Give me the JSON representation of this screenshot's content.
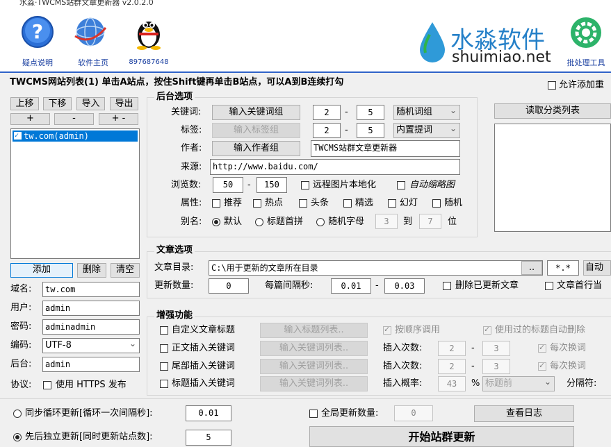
{
  "window": {
    "title": "水淼·TWCMS站群文章更新器 v2.0.2.0"
  },
  "toolbar": {
    "help_label": "疑点说明",
    "home_label": "软件主页",
    "qq_label": "897687648",
    "brand_cn": "水淼软件",
    "brand_en": "shuimiao.net",
    "batch_label": "批处理工具"
  },
  "sitelist": {
    "header": "TWCMS网站列表(1)  单击A站点，按住Shift键再单击B站点，可以A到B连续打勾",
    "allow_add": "允许添加重",
    "btn_up": "上移",
    "btn_down": "下移",
    "btn_import": "导入",
    "btn_export": "导出",
    "btn_plus1": "+",
    "btn_minus": "-",
    "btn_plusminus": "+ -",
    "items": [
      "tw.com(admin)"
    ],
    "btn_add": "添加",
    "btn_delete": "删除",
    "btn_clear": "清空",
    "domain_label": "域名:",
    "domain_value": "tw.com",
    "user_label": "用户:",
    "user_value": "admin",
    "pass_label": "密码:",
    "pass_value": "adminadmin",
    "encoding_label": "编码:",
    "encoding_value": "UTF-8",
    "backend_label": "后台:",
    "backend_value": "admin",
    "protocol_label": "协议:",
    "https_label": "使用 HTTPS 发布"
  },
  "backend": {
    "title": "后台选项",
    "keyword_label": "关键词:",
    "keyword_btn": "输入关键词组",
    "keyword_min": "2",
    "keyword_max": "5",
    "keyword_mode": "随机词组",
    "tag_label": "标签:",
    "tag_btn": "输入标签组",
    "tag_min": "2",
    "tag_max": "5",
    "tag_mode": "内置提词",
    "author_label": "作者:",
    "author_btn": "输入作者组",
    "author_value": "TWCMS站群文章更新器",
    "source_label": "来源:",
    "source_value": "http://www.baidu.com/",
    "views_label": "浏览数:",
    "views_min": "50",
    "views_max": "150",
    "remote_img": "远程图片本地化",
    "auto_thumb": "自动缩略图",
    "attr_label": "属性:",
    "attrs": [
      "推荐",
      "热点",
      "头条",
      "精选",
      "幻灯",
      "随机"
    ],
    "alias_label": "别名:",
    "alias_default": "默认",
    "alias_pinyin": "标题首拼",
    "alias_random": "随机字母",
    "alias_len_min": "3",
    "alias_to": "到",
    "alias_len_max": "7",
    "alias_unit": "位",
    "dash": "-",
    "read_cat_btn": "读取分类列表"
  },
  "article": {
    "title": "文章选项",
    "dir_label": "文章目录:",
    "dir_value": "C:\\用于更新的文章所在目录",
    "browse_btn": "..",
    "ext_value": "*.*",
    "auto_btn": "自动识",
    "count_label": "更新数量:",
    "count_value": "0",
    "interval_label": "每篇间隔秒:",
    "interval_min": "0.01",
    "interval_max": "0.03",
    "delete_updated": "删除已更新文章",
    "first_line": "文章首行当"
  },
  "enhance": {
    "title": "增强功能",
    "rows": [
      {
        "check": "自定义文章标题",
        "btn": "输入标题列表.."
      },
      {
        "check": "正文插入关键词",
        "btn": "输入关键词列表..",
        "label": "插入次数:",
        "min": "2",
        "max": "3",
        "each": "每次换词"
      },
      {
        "check": "尾部插入关键词",
        "btn": "输入关键词列表..",
        "label": "插入次数:",
        "min": "2",
        "max": "3",
        "each": "每次换词"
      },
      {
        "check": "标题插入关键词",
        "btn": "输入关键词列表..",
        "label": "插入概率:",
        "prob": "43",
        "pct": "%",
        "pos": "标题前",
        "sep": "分隔符:"
      }
    ],
    "order_call": "按顺序调用",
    "auto_delete_title": "使用过的标题自动删除"
  },
  "bottom": {
    "sync_label": "同步循环更新[循环一次间隔秒]:",
    "sync_value": "0.01",
    "seq_label": "先后独立更新[同时更新站点数]:",
    "seq_value": "5",
    "global_label": "全局更新数量:",
    "global_value": "0",
    "log_btn": "查看日志",
    "start_btn": "开始站群更新"
  }
}
